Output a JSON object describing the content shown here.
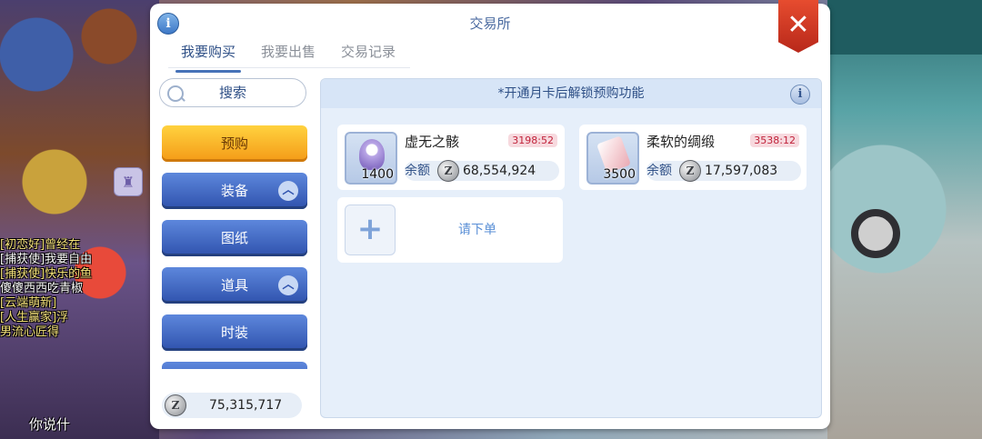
{
  "window": {
    "title": "交易所"
  },
  "tabs": [
    {
      "label": "我要购买",
      "active": true
    },
    {
      "label": "我要出售",
      "active": false
    },
    {
      "label": "交易记录",
      "active": false
    }
  ],
  "search": {
    "label": "搜索"
  },
  "categories": [
    {
      "label": "预购",
      "style": "gold"
    },
    {
      "label": "装备",
      "expandable": true
    },
    {
      "label": "图纸"
    },
    {
      "label": "道具",
      "expandable": true
    },
    {
      "label": "时装"
    }
  ],
  "balance": {
    "value": "75,315,717"
  },
  "notice": {
    "text": "*开通月卡后解锁预购功能"
  },
  "items": [
    {
      "name": "虚无之骸",
      "quantity": "1400",
      "timer": "3198:52",
      "price_label": "余额",
      "price": "68,554,924"
    },
    {
      "name": "柔软的绸缎",
      "quantity": "3500",
      "timer": "3538:12",
      "price_label": "余额",
      "price": "17,597,083"
    }
  ],
  "order": {
    "label": "请下单"
  },
  "icons": {
    "info": "i",
    "close": "✕",
    "zeny": "Z",
    "plus": "+",
    "chevron_up": "︿"
  },
  "colors": {
    "accent": "#2e4f86",
    "primary_button": "#3f67c4",
    "preorder_button": "#f7b52a",
    "close_button": "#d63a23",
    "timer": "#c0223a"
  },
  "background_chat": [
    "[初恋好]曾经在",
    "[捕获使]我要自由",
    "[捕获使]快乐的鱼",
    "傻傻西西吃青椒",
    "[云端萌新]",
    "[人生赢家]浮",
    "男流心匠得",
    "你说什"
  ]
}
